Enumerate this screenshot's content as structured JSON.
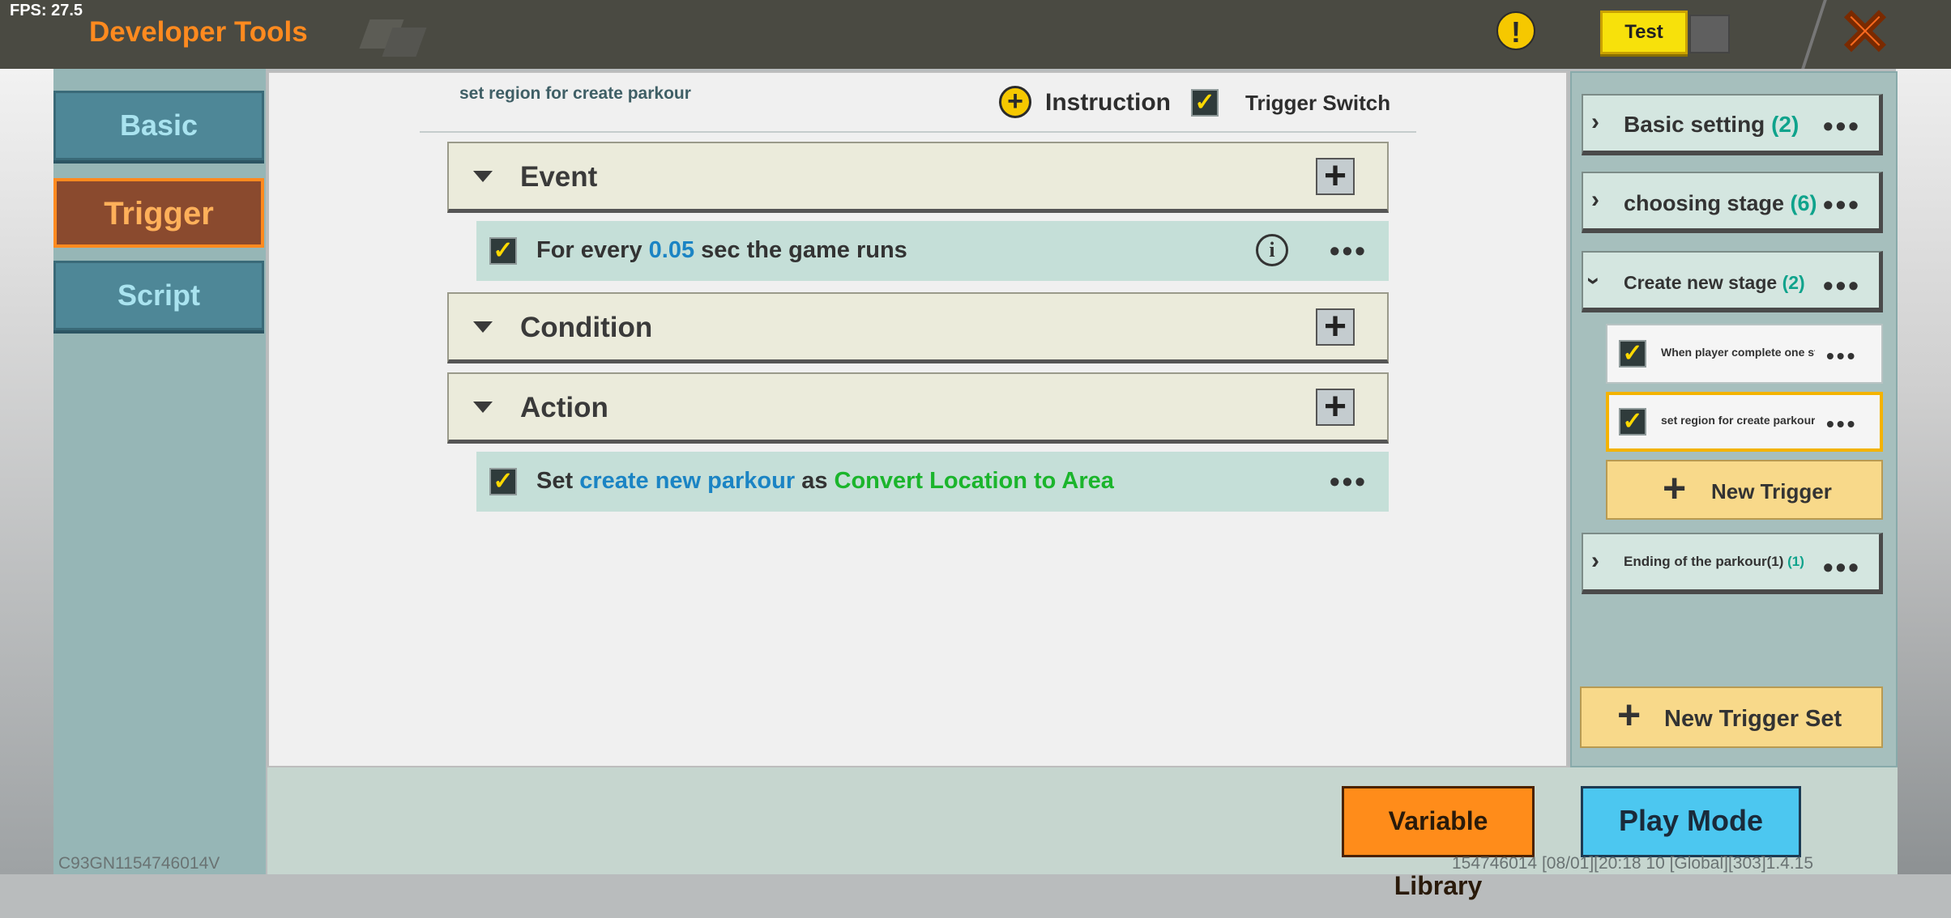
{
  "fps": "FPS: 27.5",
  "app_title": "Developer Tools",
  "header": {
    "warning_icon": "!",
    "test_label": "Test",
    "close_icon": "close-x"
  },
  "tabs": [
    {
      "label": "Basic"
    },
    {
      "label": "Trigger"
    },
    {
      "label": "Script"
    }
  ],
  "trigger": {
    "title": "set region for create parkour",
    "instruction_label": "Instruction",
    "trigger_switch_label": "Trigger Switch",
    "sections": {
      "event": "Event",
      "condition": "Condition",
      "action": "Action"
    },
    "event_row": {
      "pre": "For every ",
      "value": "0.05",
      "post": " sec the game runs"
    },
    "action_row": {
      "w1": "Set ",
      "var": "create new parkour",
      "w2": " as ",
      "func": "Convert Location to Area"
    }
  },
  "trigger_sets": [
    {
      "name": "Basic setting ",
      "count": "(2)"
    },
    {
      "name": "choosing stage ",
      "count": "(6)"
    },
    {
      "name": "Create new stage ",
      "count": "(2)"
    },
    {
      "name": "Ending of the parkour(1) ",
      "count": "(1)"
    }
  ],
  "triggers": [
    {
      "label": "When player complete one sta"
    },
    {
      "label": "set region for create parkour"
    }
  ],
  "new_trigger_label": "New Trigger",
  "new_trigger_set_label": "New Trigger Set",
  "variable_library_label": "Variable Library",
  "play_mode_label": "Play Mode",
  "footer": {
    "device_id": "C93GN1154746014V",
    "version": "154746014   [08/01][20:18 10  [Global][303]1.4.15"
  },
  "colors": {
    "accent_orange": "#ff8a1f",
    "value_blue": "#1b84c4",
    "func_green": "#1bb52c",
    "count_teal": "#0fa38c"
  }
}
